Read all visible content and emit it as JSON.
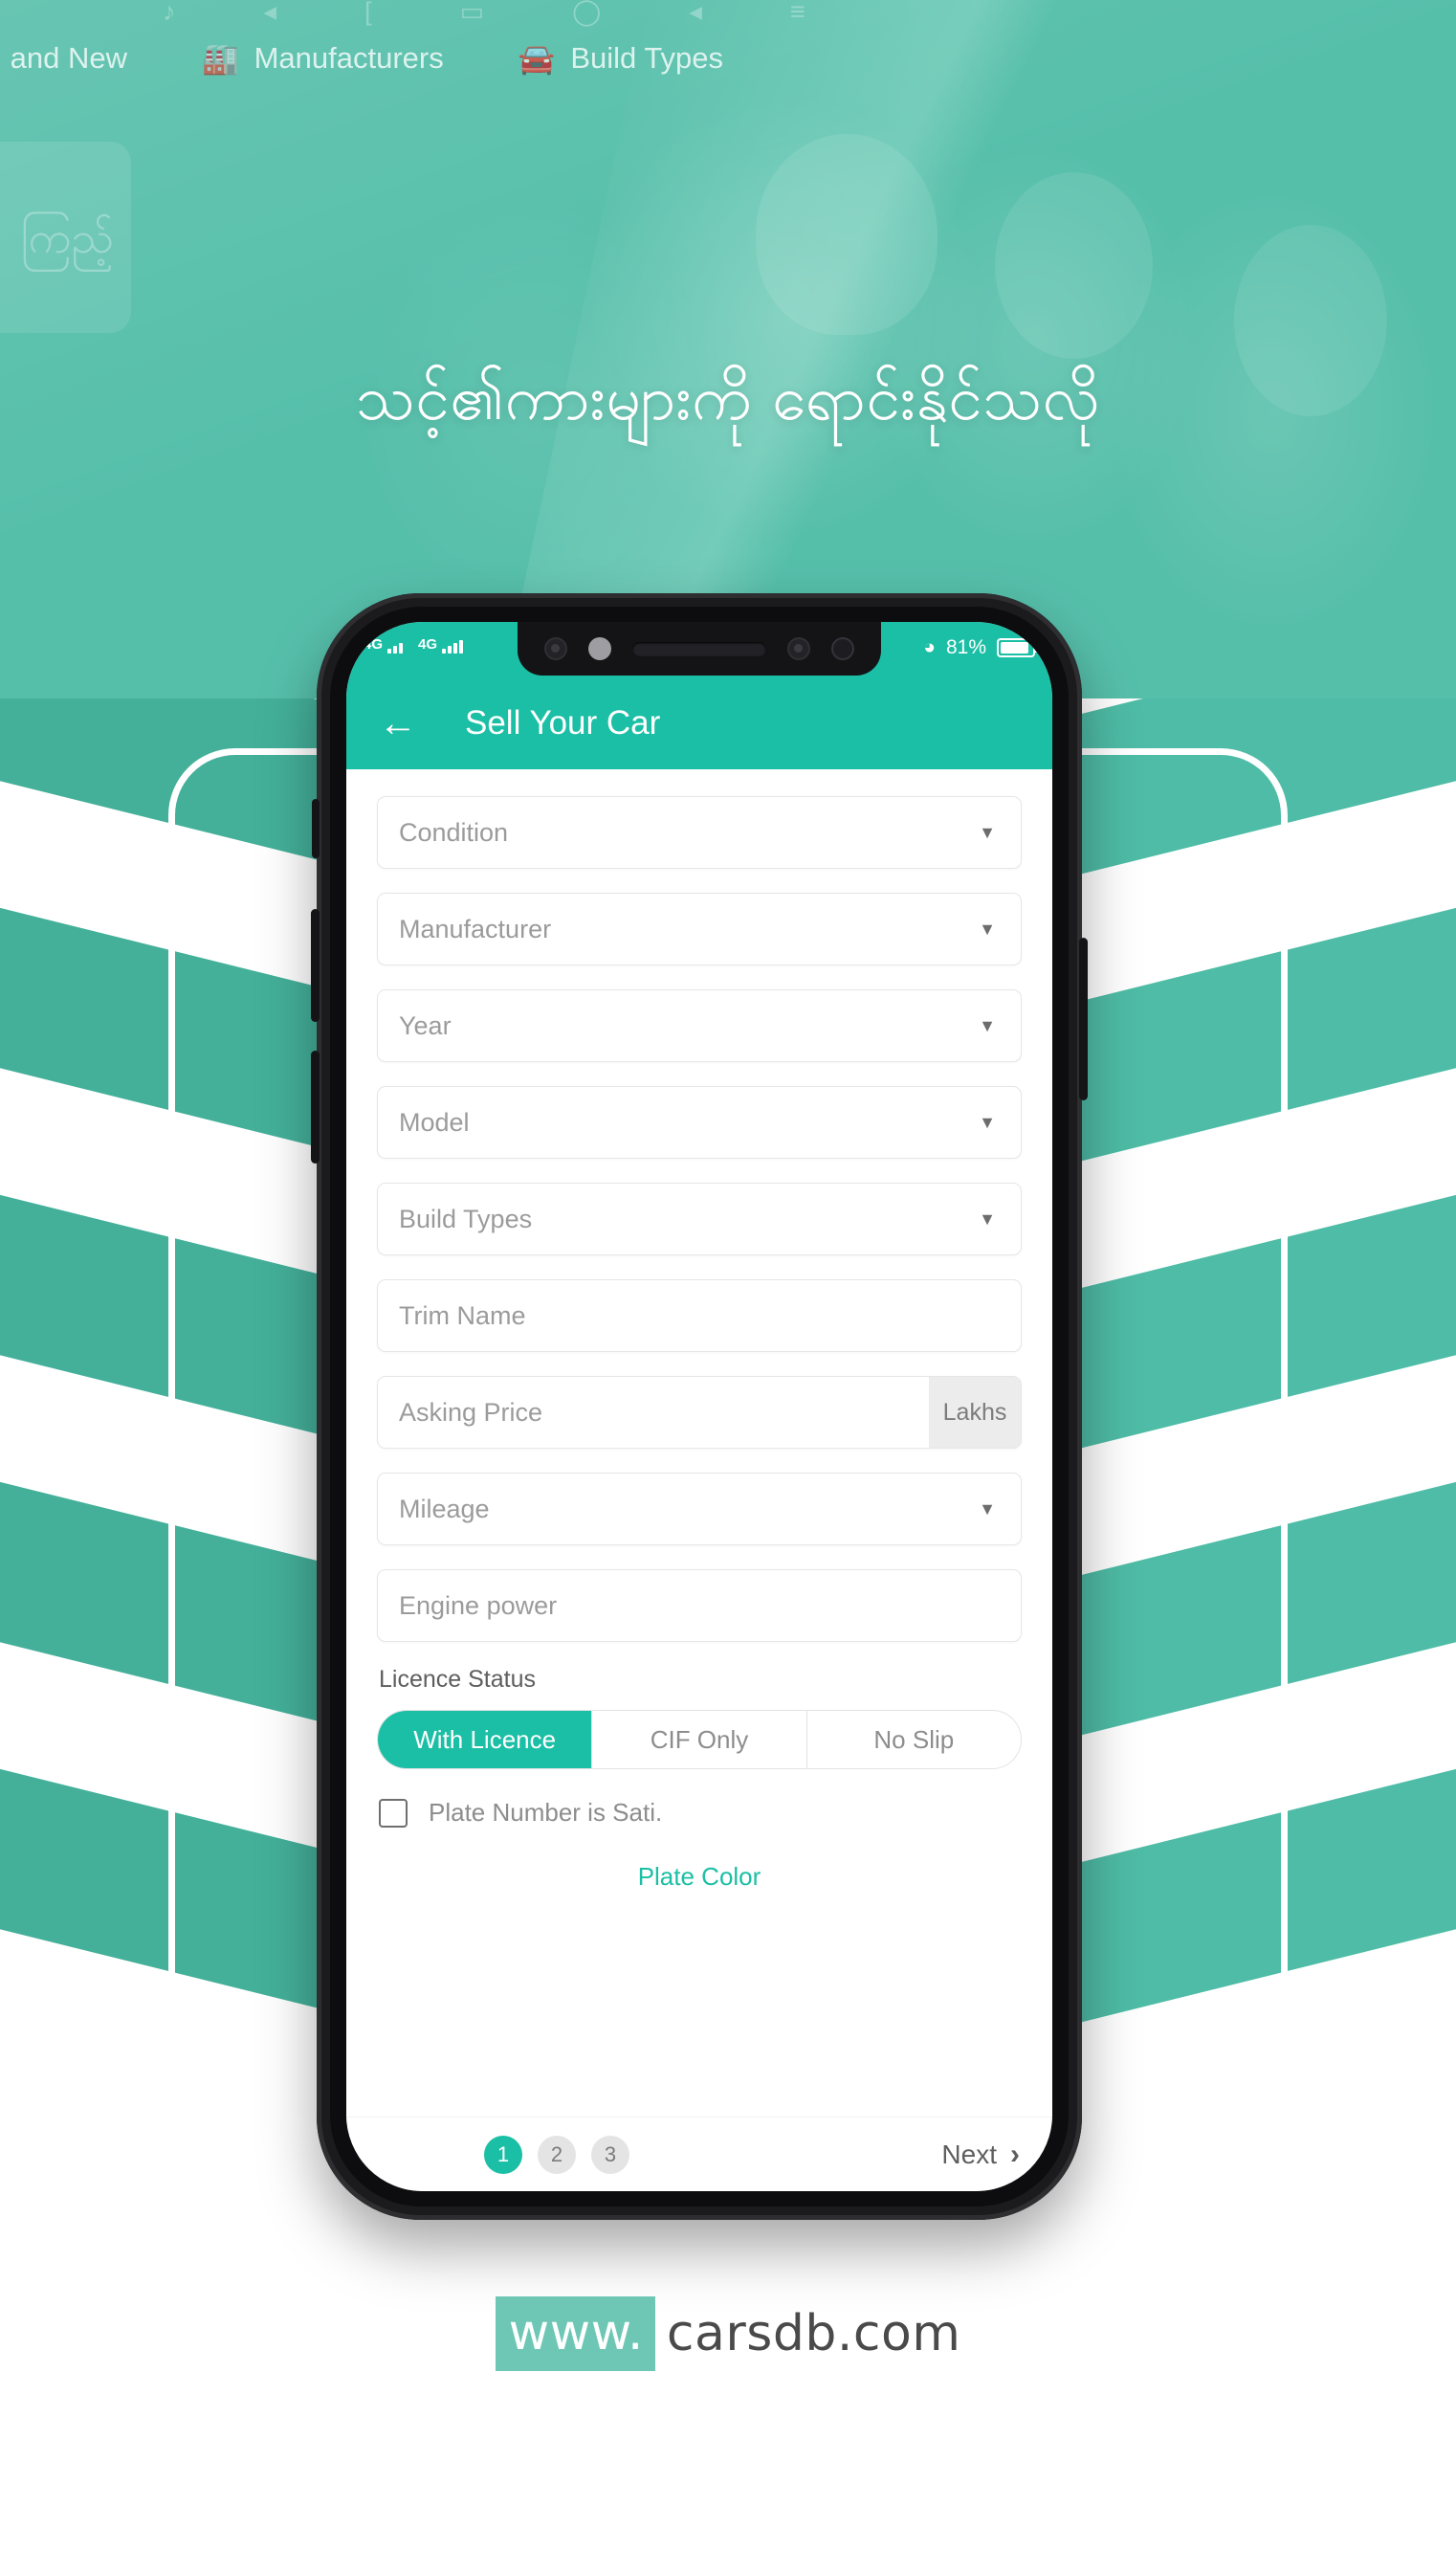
{
  "hero": {
    "headline": "သင့်၏ကားများကို ရောင်းနိုင်သလို",
    "ghost_card_text": "ကြည့်",
    "nav": [
      {
        "label": "and New",
        "icon": "car-icon"
      },
      {
        "label": "Manufacturers",
        "icon": "factory-car-icon"
      },
      {
        "label": "Build Types",
        "icon": "car-body-icon"
      }
    ]
  },
  "phone": {
    "status_bar": {
      "network_left": "4G",
      "network_right": "4G",
      "wifi_icon": "wifi-icon",
      "battery_percent": "81%",
      "battery_icon": "battery-icon"
    },
    "app_bar": {
      "back_icon": "back-arrow-icon",
      "title": "Sell Your Car"
    },
    "form": {
      "fields": [
        {
          "placeholder": "Condition",
          "type": "select",
          "name": "condition"
        },
        {
          "placeholder": "Manufacturer",
          "type": "select",
          "name": "manufacturer"
        },
        {
          "placeholder": "Year",
          "type": "select",
          "name": "year"
        },
        {
          "placeholder": "Model",
          "type": "select",
          "name": "model"
        },
        {
          "placeholder": "Build Types",
          "type": "select",
          "name": "build-types"
        },
        {
          "placeholder": "Trim Name",
          "type": "text",
          "name": "trim-name"
        },
        {
          "placeholder": "Asking Price",
          "type": "text",
          "name": "asking-price",
          "suffix": "Lakhs"
        },
        {
          "placeholder": "Mileage",
          "type": "select",
          "name": "mileage"
        },
        {
          "placeholder": "Engine power",
          "type": "text",
          "name": "engine-power"
        }
      ],
      "licence_status_label": "Licence Status",
      "licence_options": [
        {
          "label": "With Licence",
          "selected": true
        },
        {
          "label": "CIF Only",
          "selected": false
        },
        {
          "label": "No Slip",
          "selected": false
        }
      ],
      "checkbox_label": "Plate Number is Sati.",
      "plate_color_label": "Plate Color"
    },
    "bottom_bar": {
      "steps": [
        "1",
        "2",
        "3"
      ],
      "active_step": "1",
      "next_label": "Next",
      "next_icon": "chevron-right-icon"
    }
  },
  "footer": {
    "url_prefix": "www.",
    "url_rest": "carsdb.com"
  },
  "colors": {
    "brand_teal": "#1bbfa5",
    "hero_teal": "#56bfaa",
    "chevron_teal": "#4ebca6",
    "chevron_shade": "#3da68f",
    "footer_badge": "#6ec7b4"
  }
}
